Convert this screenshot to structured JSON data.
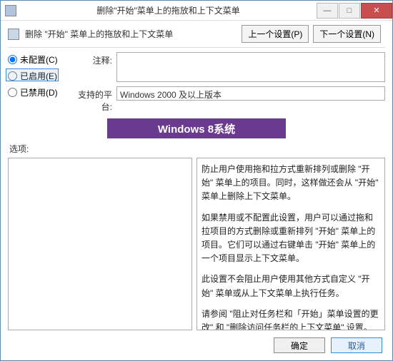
{
  "window": {
    "title": "删除\"开始\"菜单上的拖放和上下文菜单",
    "minimize": "—",
    "maximize": "□",
    "close": "✕"
  },
  "header": {
    "text": "删除 \"开始\" 菜单上的拖放和上下文菜单"
  },
  "nav": {
    "prev": "上一个设置(P)",
    "next": "下一个设置(N)"
  },
  "radios": {
    "notConfigured": "未配置(C)",
    "enabled": "已启用(E)",
    "disabled": "已禁用(D)"
  },
  "fields": {
    "commentLabel": "注释:",
    "commentValue": "",
    "platformLabel": "支持的平台:",
    "platformValue": "Windows 2000 及以上版本"
  },
  "banner": "Windows 8系统",
  "optionsLabel": "选项:",
  "help": {
    "p1": "防止用户使用拖和拉方式重新排列或删除 \"开始\" 菜单上的项目。同时，这样做还会从 \"开始\" 菜单上删除上下文菜单。",
    "p2": "如果禁用或不配置此设置，用户可以通过拖和拉项目的方式删除或重新排列 \"开始\" 菜单上的项目。它们可以通过右键单击 \"开始\" 菜单上的一个项目显示上下文菜单。",
    "p3": "此设置不会阻止用户使用其他方式自定义 \"开始\" 菜单或从上下文菜单上执行任务。",
    "p4": "请参阅 \"阻止对任务栏和「开始」菜单设置的更改\" 和 \"删除访问任务栏的上下文菜单\" 设置。"
  },
  "footer": {
    "ok": "确定",
    "cancel": "取消",
    "apply": "取消"
  }
}
